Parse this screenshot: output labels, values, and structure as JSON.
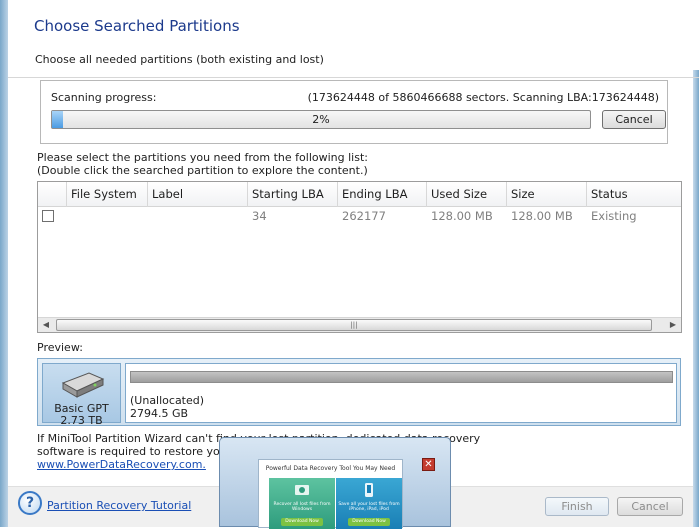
{
  "dialog": {
    "title": "Choose Searched Partitions",
    "subtitle": "Choose all needed partitions (both existing and lost)"
  },
  "scan": {
    "label": "Scanning progress:",
    "info": "(173624448 of 5860466688 sectors. Scanning LBA:173624448)",
    "progress_text": "2%",
    "progress_percent": 2,
    "cancel_label": "Cancel"
  },
  "instructions": {
    "line1": "Please select the partitions you need from the following list:",
    "line2": "(Double click the searched partition to explore the content.)"
  },
  "table": {
    "columns": [
      "File System",
      "Label",
      "Starting LBA",
      "Ending LBA",
      "Used Size",
      "Size",
      "Status"
    ],
    "rows": [
      {
        "file_system": "",
        "label": "",
        "starting_lba": "34",
        "ending_lba": "262177",
        "used_size": "128.00 MB",
        "size": "128.00 MB",
        "status": "Existing"
      }
    ]
  },
  "preview": {
    "label": "Preview:",
    "disk_name": "Basic GPT",
    "disk_size": "2.73 TB",
    "partition_name": "(Unallocated)",
    "partition_size": "2794.5 GB"
  },
  "note": {
    "line1": "If MiniTool Partition Wizard can't find your lost partition, dedicated data recovery",
    "line2": "software is required to restore your d",
    "link": "www.PowerDataRecovery.com."
  },
  "footer": {
    "tutorial_link": "Partition Recovery Tutorial",
    "finish_label": "Finish",
    "cancel_label": "Cancel"
  },
  "popup": {
    "title": "Powerful Data Recovery Tool You May Need",
    "promo_a_text": "Recover all lost files from Windows",
    "promo_b_text": "Save all your lost files from iPhone, iPad, iPod",
    "download_label": "Download Now",
    "close_glyph": "✕"
  },
  "colors": {
    "title": "#1c3a8c",
    "link": "#1a4fb5",
    "progress": "#4b9be3"
  }
}
